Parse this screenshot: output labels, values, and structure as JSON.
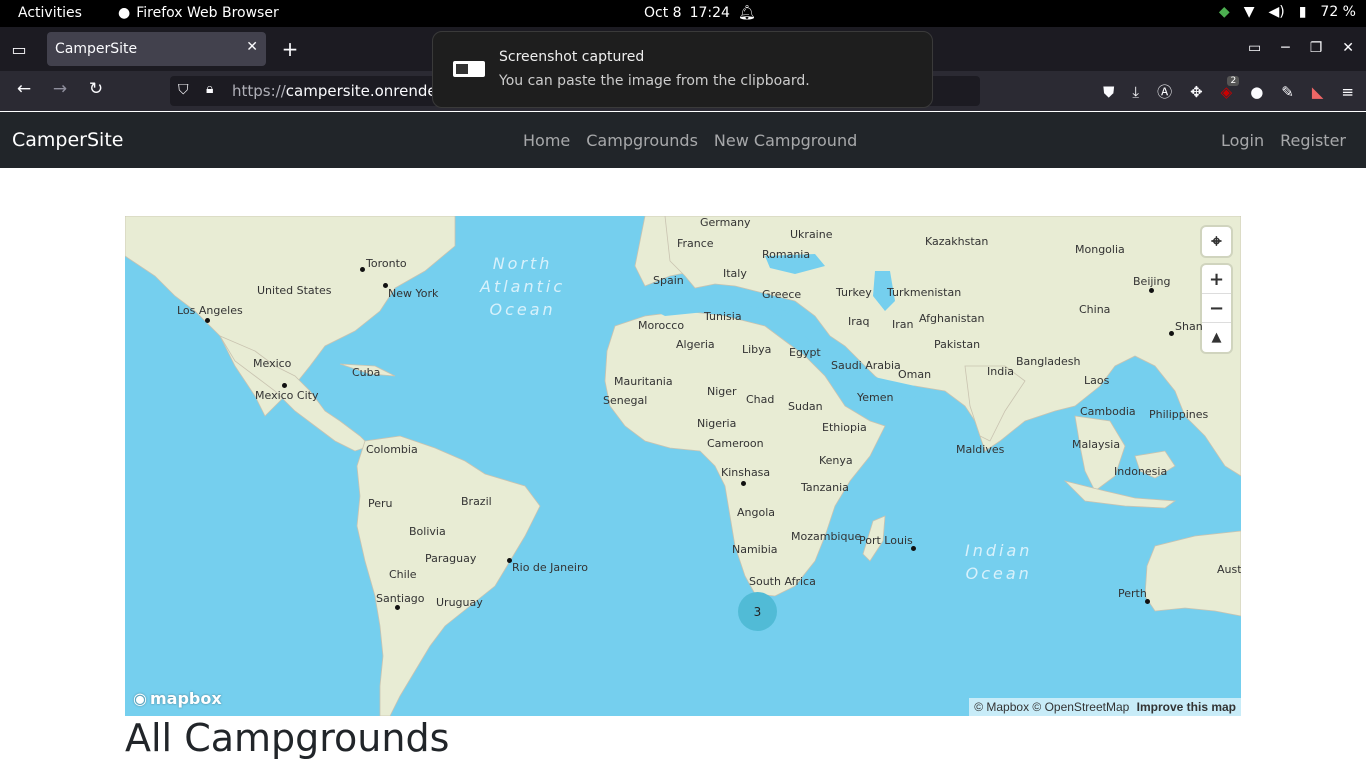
{
  "system_bar": {
    "activities": "Activities",
    "app_name": "Firefox Web Browser",
    "date": "Oct 8",
    "time": "17:24",
    "battery": "72 %"
  },
  "browser": {
    "tab_title": "CamperSite",
    "url_scheme": "https://",
    "url_host": "campersite.onrender.",
    "ext_badge": "2"
  },
  "notification": {
    "title": "Screenshot captured",
    "body": "You can paste the image from the clipboard."
  },
  "site": {
    "brand": "CamperSite",
    "nav": [
      "Home",
      "Campgrounds",
      "New Campground"
    ],
    "auth": [
      "Login",
      "Register"
    ],
    "heading": "All Campgrounds"
  },
  "map": {
    "oceans": [
      "North Atlantic Ocean",
      "Indian Ocean"
    ],
    "labels": [
      "Germany",
      "Ukraine",
      "France",
      "Romania",
      "Kazakhstan",
      "Mongolia",
      "Toronto",
      "Italy",
      "Spain",
      "Greece",
      "Turkey",
      "Turkmenistan",
      "Beijing",
      "United States",
      "New York",
      "Los Angeles",
      "Tunisia",
      "Morocco",
      "Iraq",
      "Iran",
      "Afghanistan",
      "China",
      "Shanghai",
      "Algeria",
      "Libya",
      "Egypt",
      "Pakistan",
      "Mexico",
      "Cuba",
      "Saudi Arabia",
      "Oman",
      "India",
      "Bangladesh",
      "Laos",
      "Mexico City",
      "Mauritania",
      "Niger",
      "Chad",
      "Sudan",
      "Yemen",
      "Senegal",
      "Cambodia",
      "Philippines",
      "Nigeria",
      "Ethiopia",
      "Cameroon",
      "Maldives",
      "Malaysia",
      "Colombia",
      "Kinshasa",
      "Kenya",
      "Indonesia",
      "Peru",
      "Brazil",
      "Tanzania",
      "Angola",
      "Bolivia",
      "Mozambique",
      "Port Louis",
      "Namibia",
      "Paraguay",
      "Rio de Janeiro",
      "Chile",
      "South Africa",
      "Australia",
      "Santiago",
      "Uruguay",
      "Perth"
    ],
    "cluster_count": "3",
    "logo": "mapbox",
    "attribution": "© Mapbox © OpenStreetMap",
    "improve": "Improve this map",
    "colors": {
      "water": "#75cfee",
      "land": "#e8ecd4",
      "cluster": "#51bbd6"
    }
  }
}
